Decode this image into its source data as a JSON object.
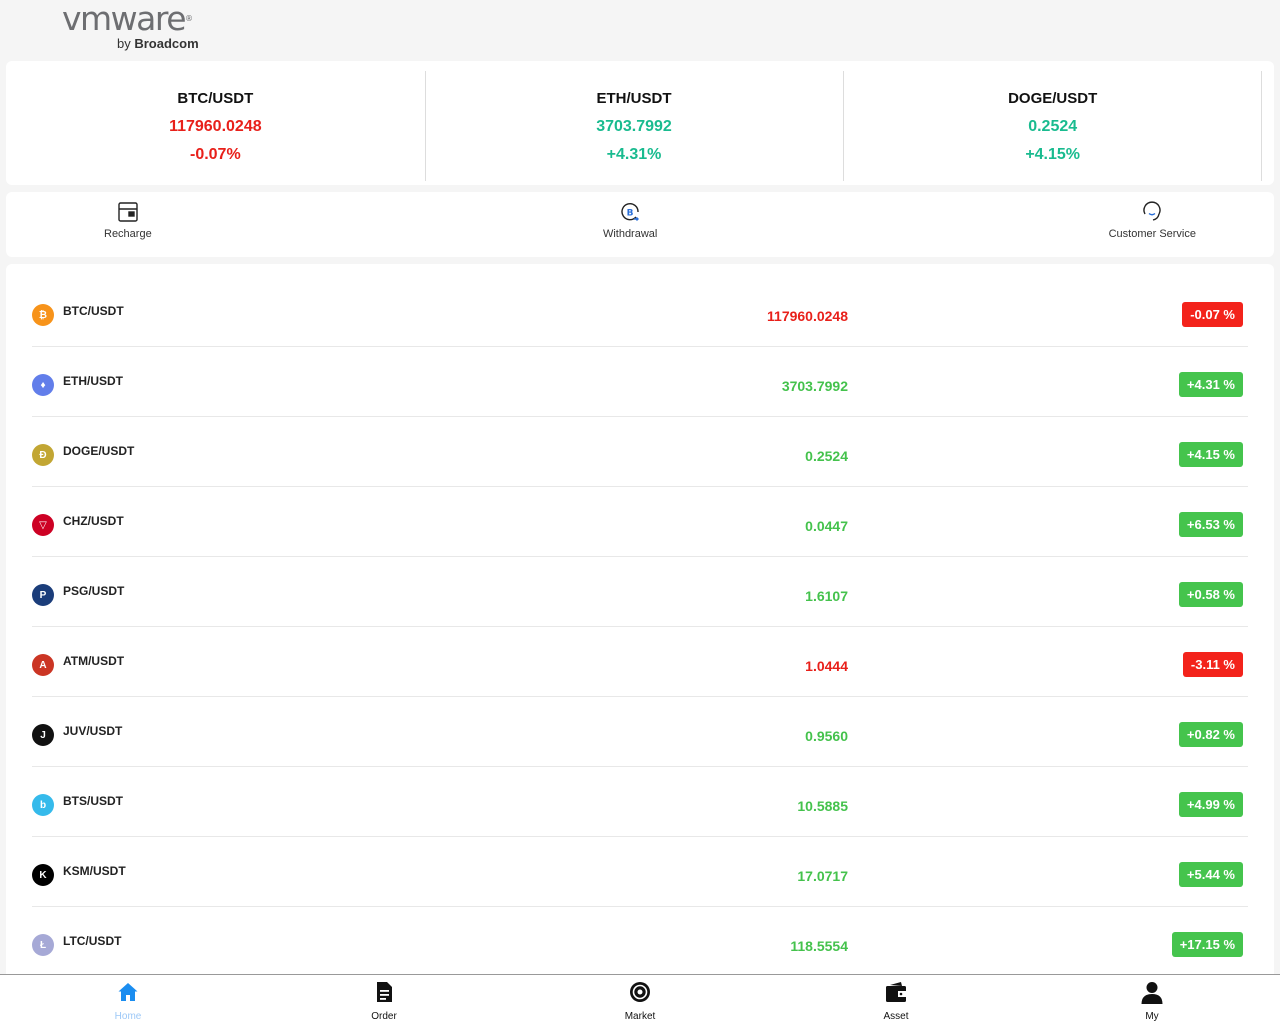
{
  "brand": {
    "logo_word": "vmware",
    "logo_by": "by ",
    "logo_company": "Broadcom"
  },
  "tickers": [
    {
      "pair": "BTC/USDT",
      "price": "117960.0248",
      "change": "-0.07%",
      "color": "#e8201a"
    },
    {
      "pair": "ETH/USDT",
      "price": "3703.7992",
      "change": "+4.31%",
      "color": "#19bb8f"
    },
    {
      "pair": "DOGE/USDT",
      "price": "0.2524",
      "change": "+4.15%",
      "color": "#19bb8f"
    }
  ],
  "actions": [
    {
      "label": "Recharge",
      "icon": "wallet-card-icon"
    },
    {
      "label": "Withdrawal",
      "icon": "coin-withdraw-icon"
    },
    {
      "label": "Customer Service",
      "icon": "headset-icon"
    }
  ],
  "market": [
    {
      "pair": "BTC/USDT",
      "price": "117960.0248",
      "change": "-0.07 %",
      "direction": "down",
      "icon_color": "#f7931a",
      "icon_glyph": "₿"
    },
    {
      "pair": "ETH/USDT",
      "price": "3703.7992",
      "change": "+4.31 %",
      "direction": "up",
      "icon_color": "#627eea",
      "icon_glyph": "♦"
    },
    {
      "pair": "DOGE/USDT",
      "price": "0.2524",
      "change": "+4.15 %",
      "direction": "up",
      "icon_color": "#c2a633",
      "icon_glyph": "Ð"
    },
    {
      "pair": "CHZ/USDT",
      "price": "0.0447",
      "change": "+6.53 %",
      "direction": "up",
      "icon_color": "#cd0124",
      "icon_glyph": "▽"
    },
    {
      "pair": "PSG/USDT",
      "price": "1.6107",
      "change": "+0.58 %",
      "direction": "up",
      "icon_color": "#1b3d7a",
      "icon_glyph": "P"
    },
    {
      "pair": "ATM/USDT",
      "price": "1.0444",
      "change": "-3.11 %",
      "direction": "down",
      "icon_color": "#cb3524",
      "icon_glyph": "A"
    },
    {
      "pair": "JUV/USDT",
      "price": "0.9560",
      "change": "+0.82 %",
      "direction": "up",
      "icon_color": "#111111",
      "icon_glyph": "J"
    },
    {
      "pair": "BTS/USDT",
      "price": "10.5885",
      "change": "+4.99 %",
      "direction": "up",
      "icon_color": "#35baeb",
      "icon_glyph": "b"
    },
    {
      "pair": "KSM/USDT",
      "price": "17.0717",
      "change": "+5.44 %",
      "direction": "up",
      "icon_color": "#000000",
      "icon_glyph": "K"
    },
    {
      "pair": "LTC/USDT",
      "price": "118.5554",
      "change": "+17.15 %",
      "direction": "up",
      "icon_color": "#a6a9d6",
      "icon_glyph": "Ł"
    }
  ],
  "nav": [
    {
      "label": "Home",
      "icon": "home-icon",
      "active": true
    },
    {
      "label": "Order",
      "icon": "document-icon",
      "active": false
    },
    {
      "label": "Market",
      "icon": "market-icon",
      "active": false
    },
    {
      "label": "Asset",
      "icon": "wallet-icon",
      "active": false
    },
    {
      "label": "My",
      "icon": "user-icon",
      "active": false
    }
  ],
  "colors": {
    "down": "#e8201a",
    "up_ticker": "#19bb8f",
    "up_list": "#44c24c",
    "nav_active": "#9cc8f7"
  }
}
